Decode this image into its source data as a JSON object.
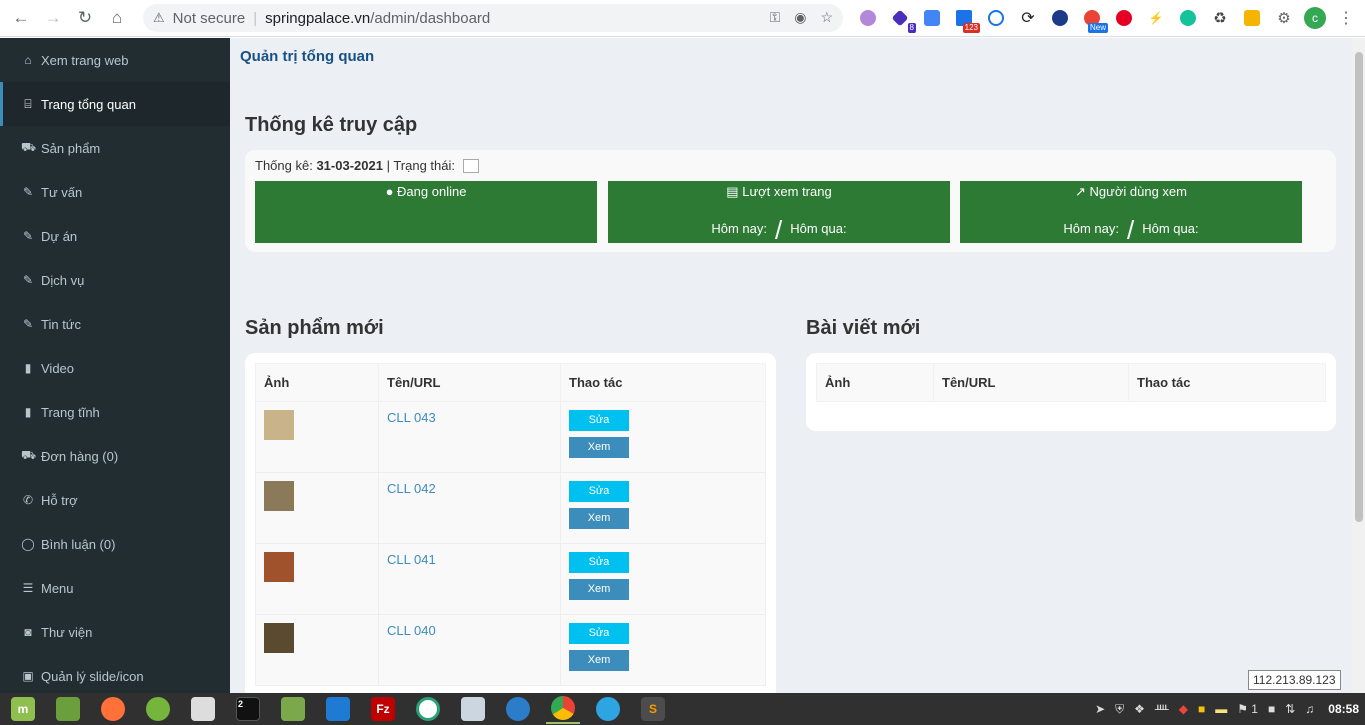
{
  "browser": {
    "not_secure": "Not secure",
    "host": "springpalace.vn",
    "path": "/admin/dashboard",
    "profile_initial": "c",
    "ext_badges": [
      "8",
      "123",
      "New"
    ]
  },
  "sidebar": {
    "items": [
      {
        "label": "Xem trang web",
        "icon": "home-icon"
      },
      {
        "label": "Trang tổng quan",
        "icon": "bank-icon",
        "active": true
      },
      {
        "label": "Sản phẩm",
        "icon": "cart-icon"
      },
      {
        "label": "Tư vấn",
        "icon": "edit-icon"
      },
      {
        "label": "Dự án",
        "icon": "edit-icon"
      },
      {
        "label": "Dịch vụ",
        "icon": "edit-icon"
      },
      {
        "label": "Tin tức",
        "icon": "edit-icon"
      },
      {
        "label": "Video",
        "icon": "book-icon"
      },
      {
        "label": "Trang tĩnh",
        "icon": "book-icon"
      },
      {
        "label": "Đơn hàng  (0)",
        "icon": "cart-icon"
      },
      {
        "label": "Hỗ trợ",
        "icon": "phone-icon"
      },
      {
        "label": "Bình luận  (0)",
        "icon": "comment-icon"
      },
      {
        "label": "Menu",
        "icon": "bars-icon"
      },
      {
        "label": "Thư viện",
        "icon": "camera-icon"
      },
      {
        "label": "Quản lý slide/icon",
        "icon": "image-icon"
      }
    ]
  },
  "main": {
    "page_title": "Quản trị tổng quan",
    "stats_title": "Thống kê truy cập",
    "stats": {
      "label": "Thống kê:",
      "date": "31-03-2021",
      "status_label": "| Trạng thái:",
      "cards": [
        {
          "title": "Đang online",
          "icon": "user-icon"
        },
        {
          "title": "Lượt xem trang",
          "icon": "bar-chart-icon",
          "today": "Hôm nay:",
          "slash": "/",
          "yesterday": "Hôm qua:"
        },
        {
          "title": "Người dùng xem",
          "icon": "line-chart-icon",
          "today": "Hôm nay:",
          "slash": "/",
          "yesterday": "Hôm qua:"
        }
      ]
    },
    "products": {
      "title": "Sản phẩm mới",
      "headers": [
        "Ảnh",
        "Tên/URL",
        "Thao tác"
      ],
      "rows": [
        {
          "name": "CLL 043",
          "edit": "Sửa",
          "view": "Xem"
        },
        {
          "name": "CLL 042",
          "edit": "Sửa",
          "view": "Xem"
        },
        {
          "name": "CLL 041",
          "edit": "Sửa",
          "view": "Xem"
        },
        {
          "name": "CLL 040",
          "edit": "Sửa",
          "view": "Xem"
        }
      ]
    },
    "posts": {
      "title": "Bài viết mới",
      "headers": [
        "Ảnh",
        "Tên/URL",
        "Thao tác"
      ]
    }
  },
  "taskbar": {
    "terminal_badge": "2",
    "tray_count": "1",
    "clock": "08:58",
    "ip_tooltip": "112.213.89.123"
  }
}
